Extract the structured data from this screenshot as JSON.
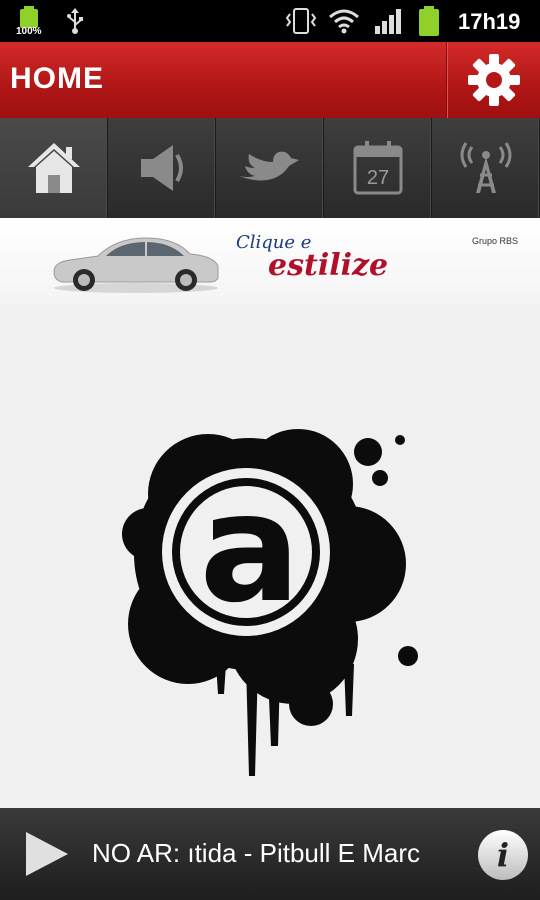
{
  "status_bar": {
    "battery_percent": "100%",
    "time": "17h19",
    "icons": [
      "battery-icon",
      "usb-icon",
      "vibrate-icon",
      "wifi-icon",
      "signal-icon",
      "battery-icon"
    ]
  },
  "header": {
    "title": "HOME",
    "settings_icon": "gear-icon"
  },
  "tabs": [
    {
      "name": "home",
      "icon": "home-icon",
      "active": true
    },
    {
      "name": "audio",
      "icon": "speaker-icon",
      "active": false
    },
    {
      "name": "twitter",
      "icon": "bird-icon",
      "active": false
    },
    {
      "name": "schedule",
      "icon": "calendar-icon",
      "label": "27",
      "active": false
    },
    {
      "name": "live",
      "icon": "antenna-icon",
      "active": false
    }
  ],
  "banner": {
    "slogan_top": "Clique e",
    "slogan_main": "estilize",
    "brand": "Grupo RBS"
  },
  "content": {
    "logo_letter": "a"
  },
  "player": {
    "now_playing": "NO AR: ıtida - Pitbull E Marc",
    "play_icon": "play-icon",
    "info_label": "i"
  },
  "colors": {
    "header_red": "#c11c1c",
    "tab_bar": "#333333",
    "player_bar": "#2a2a2a",
    "background": "#f0f0f0"
  }
}
